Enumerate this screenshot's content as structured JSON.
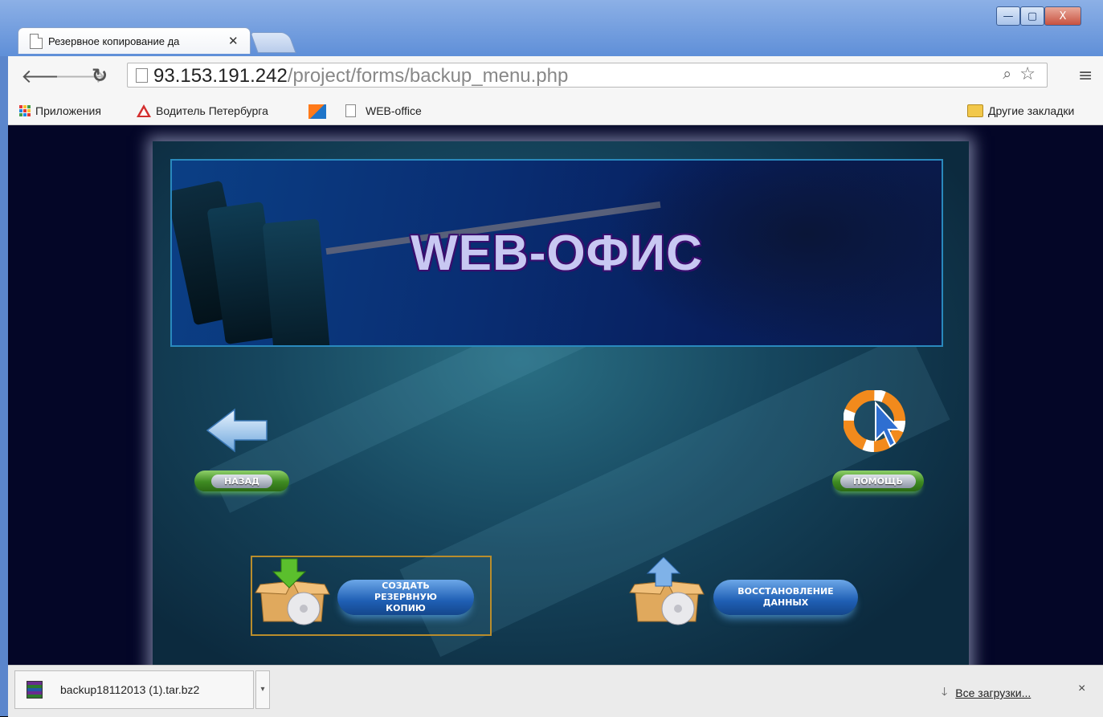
{
  "browser": {
    "tab_title": "Резервное копирование да",
    "url_host": "93.153.191.242",
    "url_path": "/project/forms/backup_menu.php",
    "window_controls": {
      "minimize": "—",
      "maximize": "▢",
      "close": "X"
    }
  },
  "bookmarks": [
    {
      "label": "Приложения",
      "icon": "apps-icon"
    },
    {
      "label": "Водитель Петербурга",
      "icon": "warning-icon"
    },
    {
      "label": "",
      "icon": "chart-icon"
    },
    {
      "label": "WEB-office",
      "icon": "page-icon"
    }
  ],
  "bookmarks_other": "Другие закладки",
  "page": {
    "logo": "WEB-ОФИС",
    "back_label": "НАЗАД",
    "help_label": "ПОМОЩЬ",
    "create_backup_label": "СОЗДАТЬ РЕЗЕРВНУЮ КОПИЮ",
    "restore_label": "ВОССТАНОВЛЕНИЕ ДАННЫХ"
  },
  "downloads": {
    "file_name": "backup18112013 (1).tar.bz2",
    "all_downloads": "Все загрузки...",
    "close": "×"
  },
  "colors": {
    "page_bg": "#040627",
    "banner_border": "#2a89bd",
    "green_button": "#3e8a22",
    "blue_button": "#1f5fb4",
    "selected_border": "#b98d2c"
  }
}
